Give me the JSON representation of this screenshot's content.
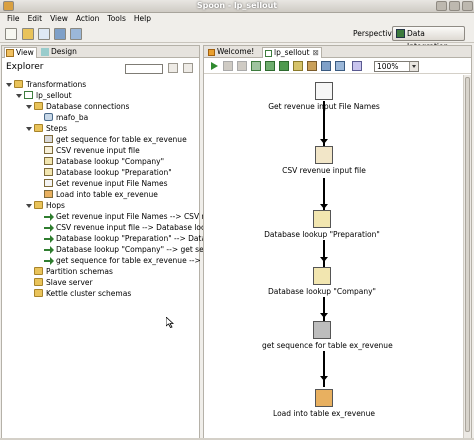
{
  "window": {
    "title": "Spoon - lp_sellout"
  },
  "menu": [
    "File",
    "Edit",
    "View",
    "Action",
    "Tools",
    "Help"
  ],
  "toolbar": {
    "perspective_label": "Perspective:",
    "perspective_value": "Data Integration"
  },
  "left_panel": {
    "tabs": [
      "View",
      "Design"
    ],
    "explorer_label": "Explorer",
    "tree": {
      "root": "Transformations",
      "transformation": "lp_sellout",
      "database_connections": "Database connections",
      "connections": [
        "mafo_ba"
      ],
      "steps_folder": "Steps",
      "steps": [
        "get sequence for table ex_revenue",
        "CSV revenue input file",
        "Database lookup \"Company\"",
        "Database lookup \"Preparation\"",
        "Get revenue input File Names",
        "Load into table ex_revenue"
      ],
      "hops_folder": "Hops",
      "hops": [
        "Get revenue input File Names --> CSV reven",
        "CSV revenue input file --> Database lookup \"",
        "Database lookup \"Preparation\" --> Database",
        "Database lookup \"Company\" --> get sequen",
        "get sequence for table ex_revenue --> Load"
      ],
      "other": [
        "Partition schemas",
        "Slave server",
        "Kettle cluster schemas"
      ]
    }
  },
  "right_panel": {
    "tabs": [
      "Welcome!",
      "lp_sellout"
    ],
    "zoom": "100%",
    "canvas_steps": [
      "Get revenue input File Names",
      "CSV revenue input file",
      "Database lookup \"Preparation\"",
      "Database lookup \"Company\"",
      "get sequence for table ex_revenue",
      "Load into table ex_revenue"
    ]
  }
}
